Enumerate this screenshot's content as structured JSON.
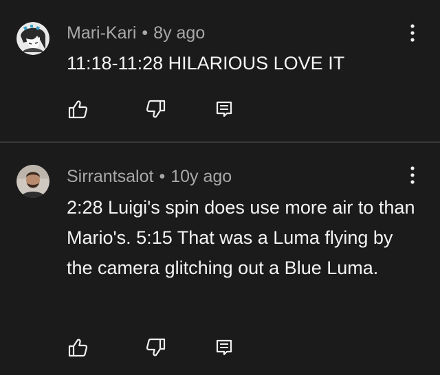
{
  "comments": [
    {
      "author": "Mari-Kari",
      "separator": "•",
      "time": "8y ago",
      "text": "11:18-11:28 HILARIOUS LOVE IT",
      "avatar": "anime-avatar",
      "actions": [
        "thumbs-up-icon",
        "thumbs-down-icon",
        "reply-icon"
      ]
    },
    {
      "author": "Sirrantsalot",
      "separator": "•",
      "time": "10y ago",
      "text": "2:28 Luigi's spin does use more air to than Mario's. 5:15 That was a Luma flying by the camera glitching out a Blue Luma.",
      "avatar": "person-avatar",
      "actions": [
        "thumbs-up-icon",
        "thumbs-down-icon",
        "reply-icon"
      ]
    }
  ],
  "colors": {
    "background": "#1b1b1b",
    "divider": "#3a3a3a",
    "meta_text": "#a8a8a8",
    "body_text": "#f4f4f4"
  }
}
